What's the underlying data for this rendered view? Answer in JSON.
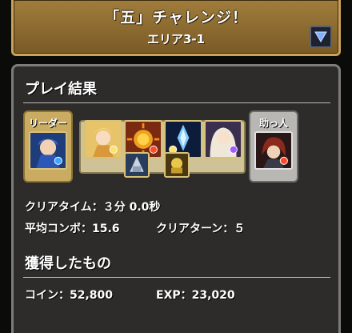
{
  "header": {
    "title": "「五」チャレンジ！",
    "area": "エリア3-1",
    "dropdown_icon": "triangle-down-icon"
  },
  "result": {
    "title": "プレイ結果",
    "leader_label": "リーダー",
    "helper_label": "助っ人",
    "team": [
      {
        "role": "leader",
        "icon": "blue-armored-warrior-monster-icon"
      },
      {
        "role": "sub",
        "icon": "light-blonde-warrior-monster-icon"
      },
      {
        "role": "sub",
        "icon": "fire-sun-monster-icon"
      },
      {
        "role": "sub",
        "icon": "blue-crystal-monster-icon"
      },
      {
        "role": "sub",
        "icon": "white-haired-goddess-monster-icon"
      },
      {
        "role": "helper",
        "icon": "dark-red-haired-monster-icon"
      },
      {
        "role": "assist",
        "icon": "silver-armor-assist-icon"
      },
      {
        "role": "assist",
        "icon": "gold-armor-assist-icon"
      }
    ],
    "clear_time": "クリアタイム：３分 0.0秒",
    "avg_combo": "平均コンボ：15.6",
    "clear_turns": "クリアターン：５"
  },
  "rewards": {
    "title": "獲得したもの",
    "coin": "コイン：52,800",
    "exp": "EXP：23,020"
  },
  "colors": {
    "header_gold": "#a07d3c",
    "panel_bg": "#2d2c2b",
    "leader_gold": "#c9ac62",
    "helper_silver": "#b8b7b3"
  }
}
